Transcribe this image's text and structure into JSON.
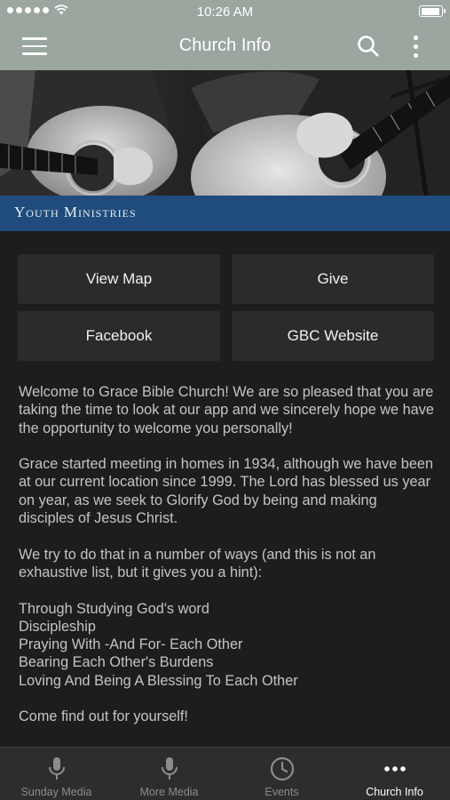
{
  "status_bar": {
    "time": "10:26 AM"
  },
  "nav_bar": {
    "title": "Church Info"
  },
  "banner": {
    "caption": "Youth Ministries"
  },
  "actions": [
    {
      "label": "View Map"
    },
    {
      "label": "Give"
    },
    {
      "label": "Facebook"
    },
    {
      "label": "GBC Website"
    }
  ],
  "content": {
    "paragraph_1": "Welcome to Grace Bible Church!  We are so pleased that you are taking the time to look at our app and we sincerely hope we have the opportunity to welcome you personally!",
    "paragraph_2": "Grace started meeting in homes in 1934, although we have been at our current location since 1999.  The Lord has blessed us year on year, as we seek to Glorify God by being and making disciples of Jesus Christ.",
    "paragraph_3": "We try to do that in a number of ways (and this is not an exhaustive list, but it gives you a hint):",
    "list": [
      "Through Studying God's word",
      "Discipleship",
      "Praying With -And For- Each Other",
      "Bearing Each Other's Burdens",
      "Loving And Being A Blessing To Each Other"
    ],
    "closing": "Come find out for yourself!"
  },
  "tabs": [
    {
      "label": "Sunday Media",
      "icon": "microphone-icon",
      "active": false
    },
    {
      "label": "More Media",
      "icon": "microphone-icon",
      "active": false
    },
    {
      "label": "Events",
      "icon": "clock-icon",
      "active": false
    },
    {
      "label": "Church Info",
      "icon": "more-horizontal-icon",
      "active": true
    }
  ],
  "colors": {
    "header": "#9aa69e",
    "background": "#1c1d1f",
    "banner_caption": "#1f4c7c",
    "button": "#2b2b2c",
    "tab_bar": "#2c2d2f"
  }
}
